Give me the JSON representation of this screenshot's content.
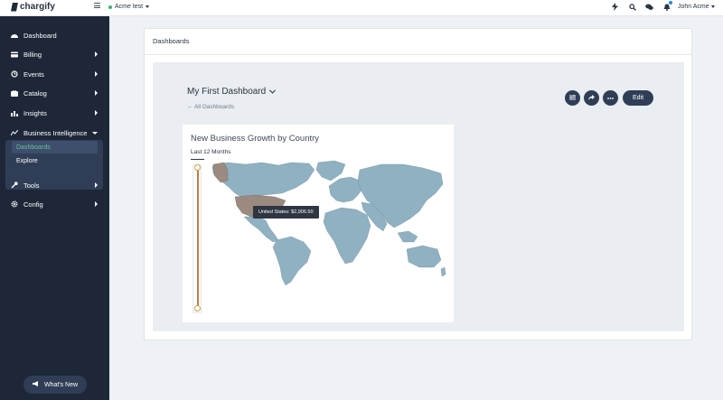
{
  "brand": {
    "name": "chargify"
  },
  "topbar": {
    "site_name": "Acme test",
    "user_name": "John Acme"
  },
  "sidebar": {
    "items": [
      {
        "label": "Dashboard",
        "icon": "dashboard-icon",
        "has_arrow": false
      },
      {
        "label": "Billing",
        "icon": "billing-icon",
        "has_arrow": true
      },
      {
        "label": "Events",
        "icon": "events-icon",
        "has_arrow": true
      },
      {
        "label": "Catalog",
        "icon": "catalog-icon",
        "has_arrow": true
      },
      {
        "label": "Insights",
        "icon": "insights-icon",
        "has_arrow": true
      },
      {
        "label": "Business Intelligence",
        "icon": "business-intelligence-icon",
        "has_arrow": true,
        "expanded": true
      },
      {
        "label": "Tools",
        "icon": "tools-icon",
        "has_arrow": true
      },
      {
        "label": "Config",
        "icon": "config-icon",
        "has_arrow": true
      }
    ],
    "sub_items": [
      {
        "label": "Dashboards",
        "active": true
      },
      {
        "label": "Explore",
        "active": false
      }
    ],
    "whats_new": "What's New"
  },
  "page": {
    "title": "Dashboards"
  },
  "dashboard": {
    "name": "My First Dashboard",
    "back_link": "← All Dashboards",
    "edit_label": "Edit",
    "actions": [
      "filter-icon",
      "share-icon",
      "more-icon"
    ]
  },
  "widget": {
    "title": "New Business Growth by Country",
    "period": "Last 12 Months",
    "tooltip": "United States: $2,906.50",
    "colors": {
      "highlight": "#9a8a80",
      "land": "#8fb1c1",
      "slider": "#c47d3f",
      "accent": "#68c29a",
      "sidebar": "#1d2738"
    }
  }
}
